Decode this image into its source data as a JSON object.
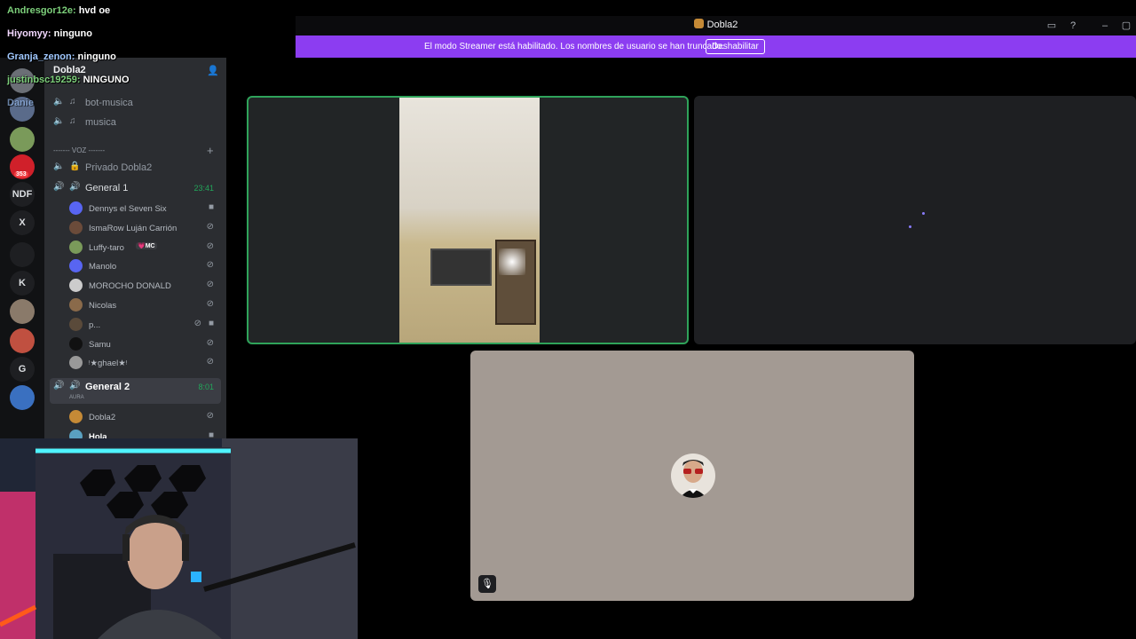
{
  "window": {
    "title": "Dobla2"
  },
  "banner": {
    "message": "El modo Streamer está habilitado. Los nombres de usuario se han truncado.",
    "button": "Deshabilitar"
  },
  "rail": {
    "servers": [
      {
        "label": "",
        "color": "#6b6f76"
      },
      {
        "label": "",
        "color": "#5a6b8a"
      },
      {
        "label": "",
        "color": "#7a9a5a"
      },
      {
        "label": "",
        "color": "#d0202a"
      },
      {
        "label": "NDF",
        "color": "#1e1f22"
      },
      {
        "label": "X",
        "color": "#1e1f22"
      },
      {
        "label": "",
        "color": "#1e1f22"
      },
      {
        "label": "K",
        "color": "#1e1f22"
      },
      {
        "label": "",
        "color": "#8a7a6a"
      },
      {
        "label": "",
        "color": "#c05040"
      },
      {
        "label": "G",
        "color": "#1e1f22"
      },
      {
        "label": "",
        "color": "#3a70c0"
      }
    ],
    "badge": "353"
  },
  "sidebar": {
    "server_name": "Dobla2",
    "text_channels": [
      {
        "label": "bot-musica"
      },
      {
        "label": "musica"
      }
    ],
    "voice_category": "------- VOZ -------",
    "voice_channels": [
      {
        "label": "Privado Dobla2"
      },
      {
        "label": "General 1",
        "time": "23:41"
      },
      {
        "label": "General 2",
        "time": "8:01",
        "sub": "AURA"
      }
    ],
    "general1_users": [
      {
        "name": "Dennys el Seven Six"
      },
      {
        "name": "IsmaRow Luján Carrión"
      },
      {
        "name": "Luffy-taro",
        "badge": "💗MC"
      },
      {
        "name": "Manolo"
      },
      {
        "name": "MOROCHO DONALD"
      },
      {
        "name": "Nicolas"
      },
      {
        "name": "p..."
      },
      {
        "name": "Samu"
      },
      {
        "name": "ᵎ★ghael★ᵎ"
      }
    ],
    "general2_users": [
      {
        "name": "Dobla2"
      },
      {
        "name": "Hola"
      }
    ]
  },
  "chat": [
    {
      "user": "Andresgor12e:",
      "text": "hvd oe"
    },
    {
      "user": "Hiyomyy:",
      "text": "ninguno"
    },
    {
      "user": "Granja_zenon:",
      "text": "ninguno"
    },
    {
      "user": "justinbsc19259:",
      "text": "NINGUNO"
    },
    {
      "user": "Danie",
      "text": ""
    }
  ],
  "colors": {
    "accent": "#8c3df1",
    "speaking": "#2fa35a"
  }
}
